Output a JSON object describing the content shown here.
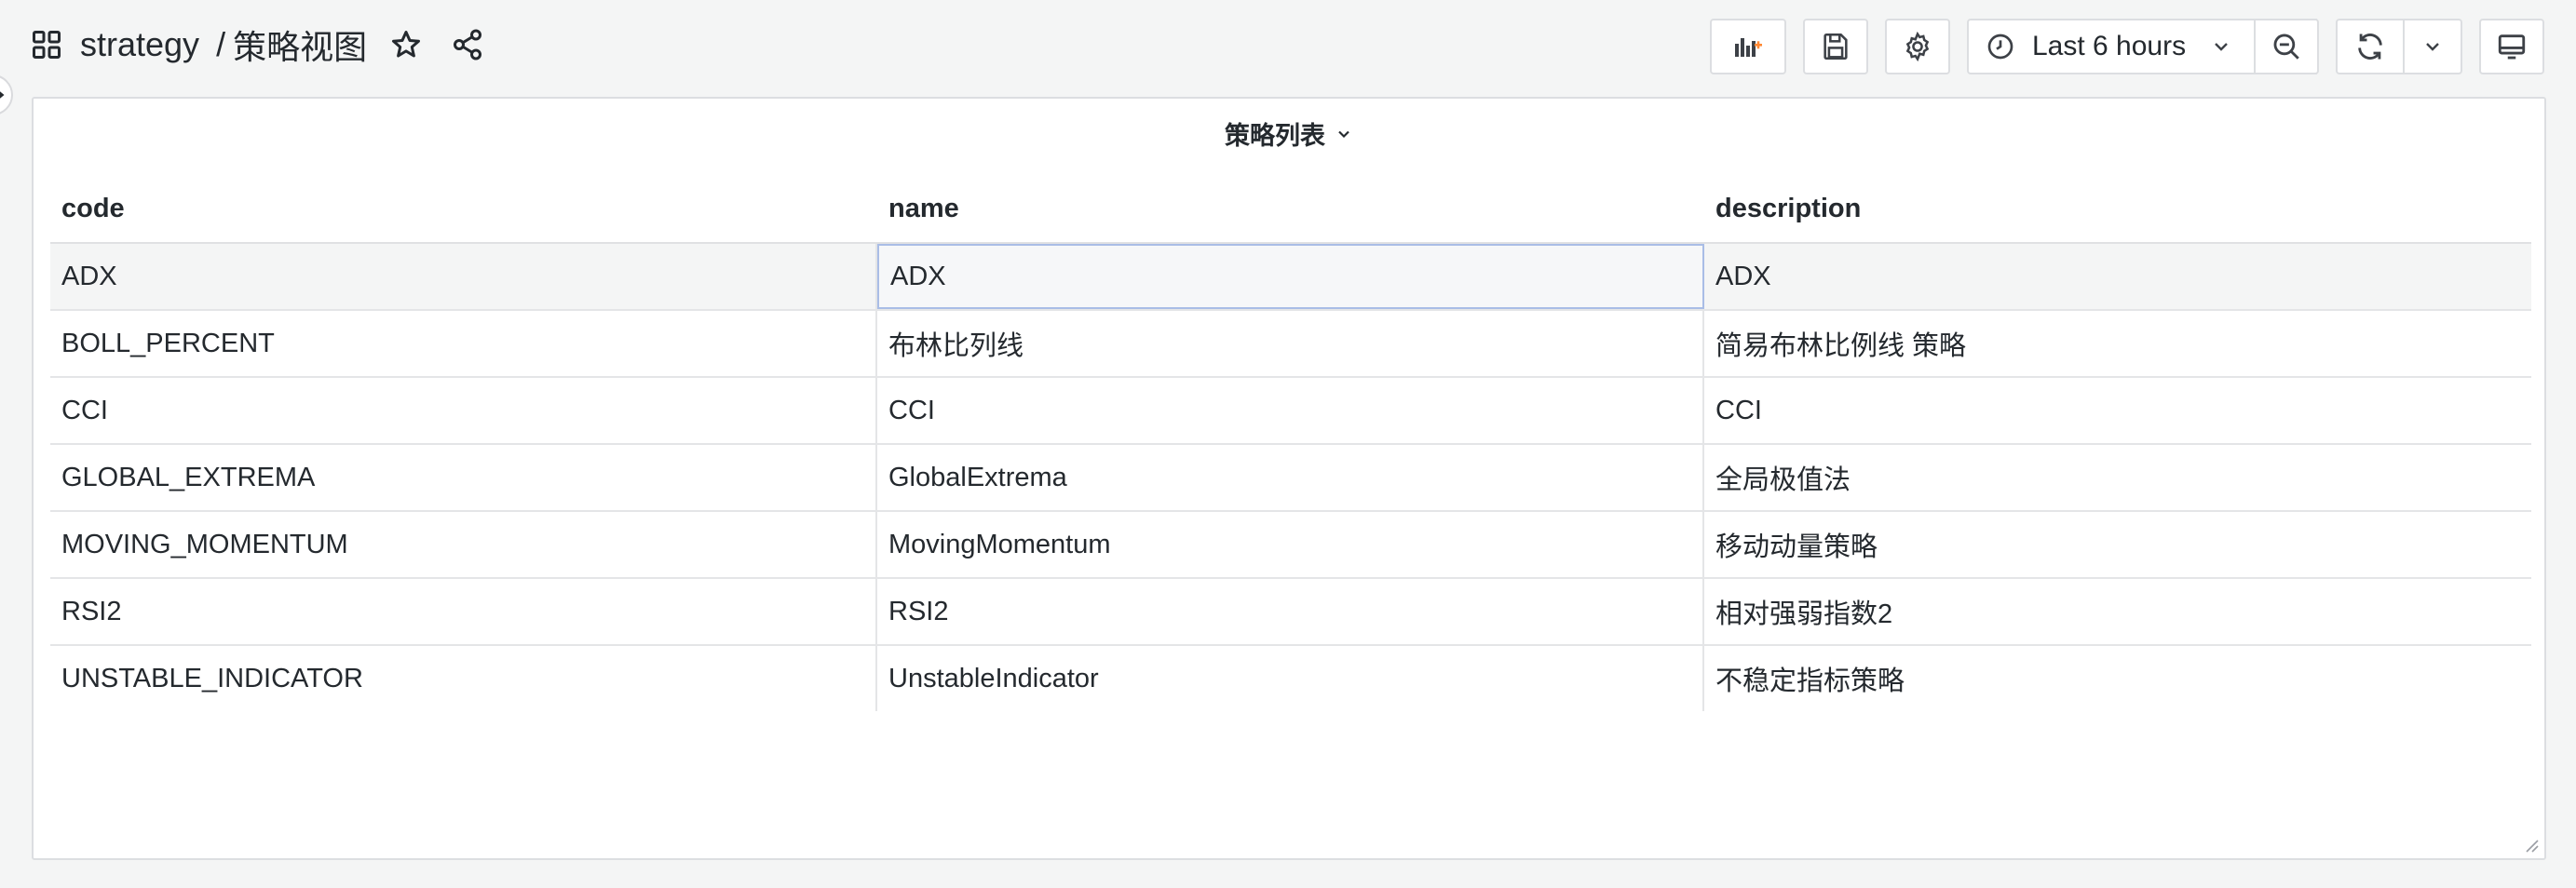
{
  "header": {
    "folder": "strategy",
    "separator": "/",
    "dashboard_title": "策略视图",
    "time_range": "Last 6 hours"
  },
  "panel": {
    "title": "策略列表"
  },
  "table": {
    "columns": [
      "code",
      "name",
      "description"
    ],
    "rows": [
      [
        "ADX",
        "ADX",
        "ADX"
      ],
      [
        "BOLL_PERCENT",
        "布林比列线",
        "简易布林比例线 策略"
      ],
      [
        "CCI",
        "CCI",
        "CCI"
      ],
      [
        "GLOBAL_EXTREMA",
        "GlobalExtrema",
        "全局极值法"
      ],
      [
        "MOVING_MOMENTUM",
        "MovingMomentum",
        "移动动量策略"
      ],
      [
        "RSI2",
        "RSI2",
        "相对强弱指数2"
      ],
      [
        "UNSTABLE_INDICATOR",
        "UnstableIndicator",
        "不稳定指标策略"
      ]
    ]
  },
  "colors": {
    "accent": "#ff8833",
    "selected_cell_border": "#a9bde6"
  }
}
